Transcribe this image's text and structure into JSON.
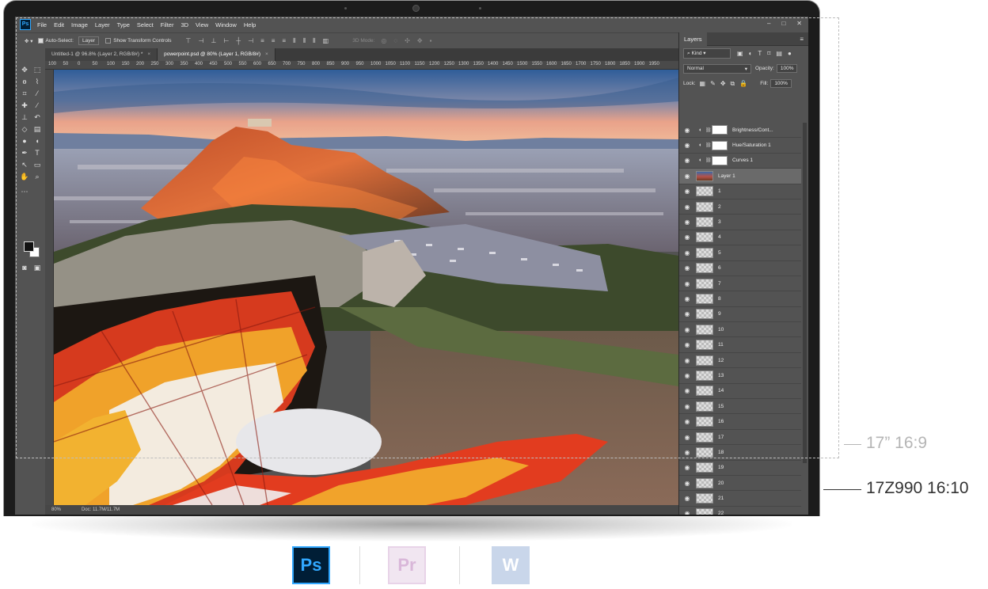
{
  "annotations": {
    "label_169": "17” 16:9",
    "label_1610": "17Z990 16:10"
  },
  "photoshop": {
    "app_logo_text": "Ps",
    "menu": [
      "File",
      "Edit",
      "Image",
      "Layer",
      "Type",
      "Select",
      "Filter",
      "3D",
      "View",
      "Window",
      "Help"
    ],
    "window_controls": [
      "–",
      "□",
      "✕"
    ],
    "options_bar": {
      "auto_select_label": "Auto-Select:",
      "auto_select_value": "Layer",
      "transform_controls_label": "Show Transform Controls",
      "mode_3d_label": "3D Mode:"
    },
    "tabs": [
      {
        "label": "Untitled-1 @ 96.8% (Layer 2, RGB/8#) *",
        "active": false
      },
      {
        "label": "powerpoint.psd @ 80% (Layer 1, RGB/8#)",
        "active": true
      }
    ],
    "ruler_ticks": [
      "100",
      "50",
      "0",
      "50",
      "100",
      "150",
      "200",
      "250",
      "300",
      "350",
      "400",
      "450",
      "500",
      "550",
      "600",
      "650",
      "700",
      "750",
      "800",
      "850",
      "900",
      "950",
      "1000",
      "1050",
      "1100",
      "1150",
      "1200",
      "1250",
      "1300",
      "1350",
      "1400",
      "1450",
      "1500",
      "1550",
      "1600",
      "1650",
      "1700",
      "1750",
      "1800",
      "1850",
      "1900",
      "1950"
    ],
    "status": {
      "zoom": "80%",
      "doc": "Doc: 11.7M/11.7M"
    },
    "layers_panel": {
      "title": "Layers",
      "filter_kind": "Kind",
      "blend_mode": "Normal",
      "opacity_label": "Opacity:",
      "opacity_value": "100%",
      "lock_label": "Lock:",
      "fill_label": "Fill:",
      "fill_value": "100%",
      "layers": [
        {
          "name": "Brightness/Cont...",
          "kind": "adjustment"
        },
        {
          "name": "Hue/Saturation 1",
          "kind": "adjustment"
        },
        {
          "name": "Curves 1",
          "kind": "adjustment"
        },
        {
          "name": "Layer 1",
          "kind": "photo",
          "selected": true
        },
        {
          "name": "1",
          "kind": "layer"
        },
        {
          "name": "2",
          "kind": "layer"
        },
        {
          "name": "3",
          "kind": "layer"
        },
        {
          "name": "4",
          "kind": "layer"
        },
        {
          "name": "5",
          "kind": "layer"
        },
        {
          "name": "6",
          "kind": "layer"
        },
        {
          "name": "7",
          "kind": "layer"
        },
        {
          "name": "8",
          "kind": "layer"
        },
        {
          "name": "9",
          "kind": "layer"
        },
        {
          "name": "10",
          "kind": "layer"
        },
        {
          "name": "11",
          "kind": "layer"
        },
        {
          "name": "12",
          "kind": "layer"
        },
        {
          "name": "13",
          "kind": "layer"
        },
        {
          "name": "14",
          "kind": "layer"
        },
        {
          "name": "15",
          "kind": "layer"
        },
        {
          "name": "16",
          "kind": "layer"
        },
        {
          "name": "17",
          "kind": "layer"
        },
        {
          "name": "18",
          "kind": "layer"
        },
        {
          "name": "19",
          "kind": "layer"
        },
        {
          "name": "20",
          "kind": "layer"
        },
        {
          "name": "21",
          "kind": "layer"
        },
        {
          "name": "22",
          "kind": "layer"
        }
      ]
    }
  },
  "apps": [
    {
      "name": "photoshop-app-icon",
      "text": "Ps",
      "fg": "#31a8ff",
      "bg": "#001e36"
    },
    {
      "name": "premiere-app-icon",
      "text": "Pr",
      "fg": "#d9b7d9",
      "bg": "#f1e6f1"
    },
    {
      "name": "word-app-icon",
      "text": "W",
      "fg": "#ffffff",
      "bg": "#c9d6ea"
    }
  ],
  "colors": {
    "annotation_gray": "#b5b5b5",
    "annotation_dark": "#333333",
    "ps_ui_bg": "#535353"
  }
}
